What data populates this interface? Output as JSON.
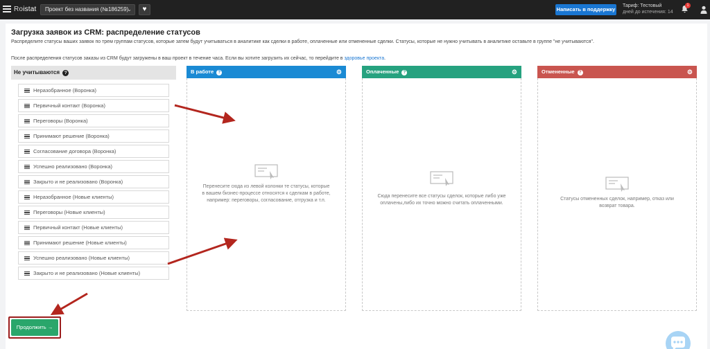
{
  "topbar": {
    "logo_prefix": "Ro",
    "logo_suffix": "istat",
    "project_name": "Проект без названия (№186259)",
    "support_label": "Написать в поддержку",
    "tariff_label": "Тариф: Тестовый",
    "tariff_days": "дней до истечения: 14",
    "notification_count": "1"
  },
  "page": {
    "title": "Загрузка заявок из CRM: распределение статусов",
    "description": "Распределите статусы ваших заявок по трем группам статусов, которые затем будут учитываться в аналитике как сделки в работе, оплаченные или отмененные сделки. Статусы, которые не нужно учитывать в аналитике оставьте в группе \"не учитываются\".",
    "note_text": "После распределения статусов заказы из CRM будут загружены в ваш проект в течение часа. Если вы хотите загрузить их сейчас, то перейдите в ",
    "note_link": "здоровье проекта",
    "note_end": "."
  },
  "ignored": {
    "title": "Не учитываются",
    "items": [
      "Неразобранное (Воронка)",
      "Первичный контакт (Воронка)",
      "Переговоры (Воронка)",
      "Принимают решение (Воронка)",
      "Согласование договора (Воронка)",
      "Успешно реализовано (Воронка)",
      "Закрыто и не реализовано (Воронка)",
      "Неразобранное (Новые клиенты)",
      "Переговоры (Новые клиенты)",
      "Первичный контакт (Новые клиенты)",
      "Принимают решение (Новые клиенты)",
      "Успешно реализовано (Новые клиенты)",
      "Закрыто и не реализовано (Новые клиенты)"
    ]
  },
  "groups": {
    "in_work": {
      "title": "В работе",
      "color": "#1a8ad4",
      "hint": "Перенесите сюда из левой колонки те статусы, которые в вашем бизнес-процессе относятся к сделкам в работе, например: переговоры, согласование, отгрузка и т.п."
    },
    "paid": {
      "title": "Оплаченные",
      "color": "#26a27f",
      "hint": "Сюда перенесите все статусы сделок, которые либо уже оплачены,либо их точно можно считать оплаченными."
    },
    "cancelled": {
      "title": "Отмененные",
      "color": "#c9554f",
      "hint": "Статусы отмененных сделок, например, отказ или возврат товара."
    }
  },
  "actions": {
    "continue_label": "Продолжить →"
  },
  "colors": {
    "topbar": "#212121",
    "support_button": "#1976d2",
    "continue_button": "#2aa66b",
    "annotation_arrow": "#b3261e"
  }
}
